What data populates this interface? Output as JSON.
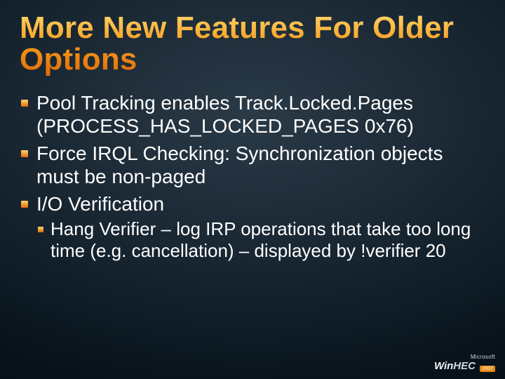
{
  "title": "More New Features For Older Options",
  "bullets": [
    {
      "text": "Pool Tracking enables Track.Locked.Pages (PROCESS_HAS_LOCKED_PAGES 0x76)"
    },
    {
      "text": "Force IRQL Checking:  Synchronization objects must be non-paged"
    },
    {
      "text": "I/O Verification",
      "sub": [
        {
          "text": "Hang Verifier – log IRP operations that take too long time (e.g. cancellation) – displayed by !verifier 20"
        }
      ]
    }
  ],
  "logo": {
    "vendor": "Microsoft",
    "product_a": "Win",
    "product_b": "HEC",
    "year": "2007"
  }
}
